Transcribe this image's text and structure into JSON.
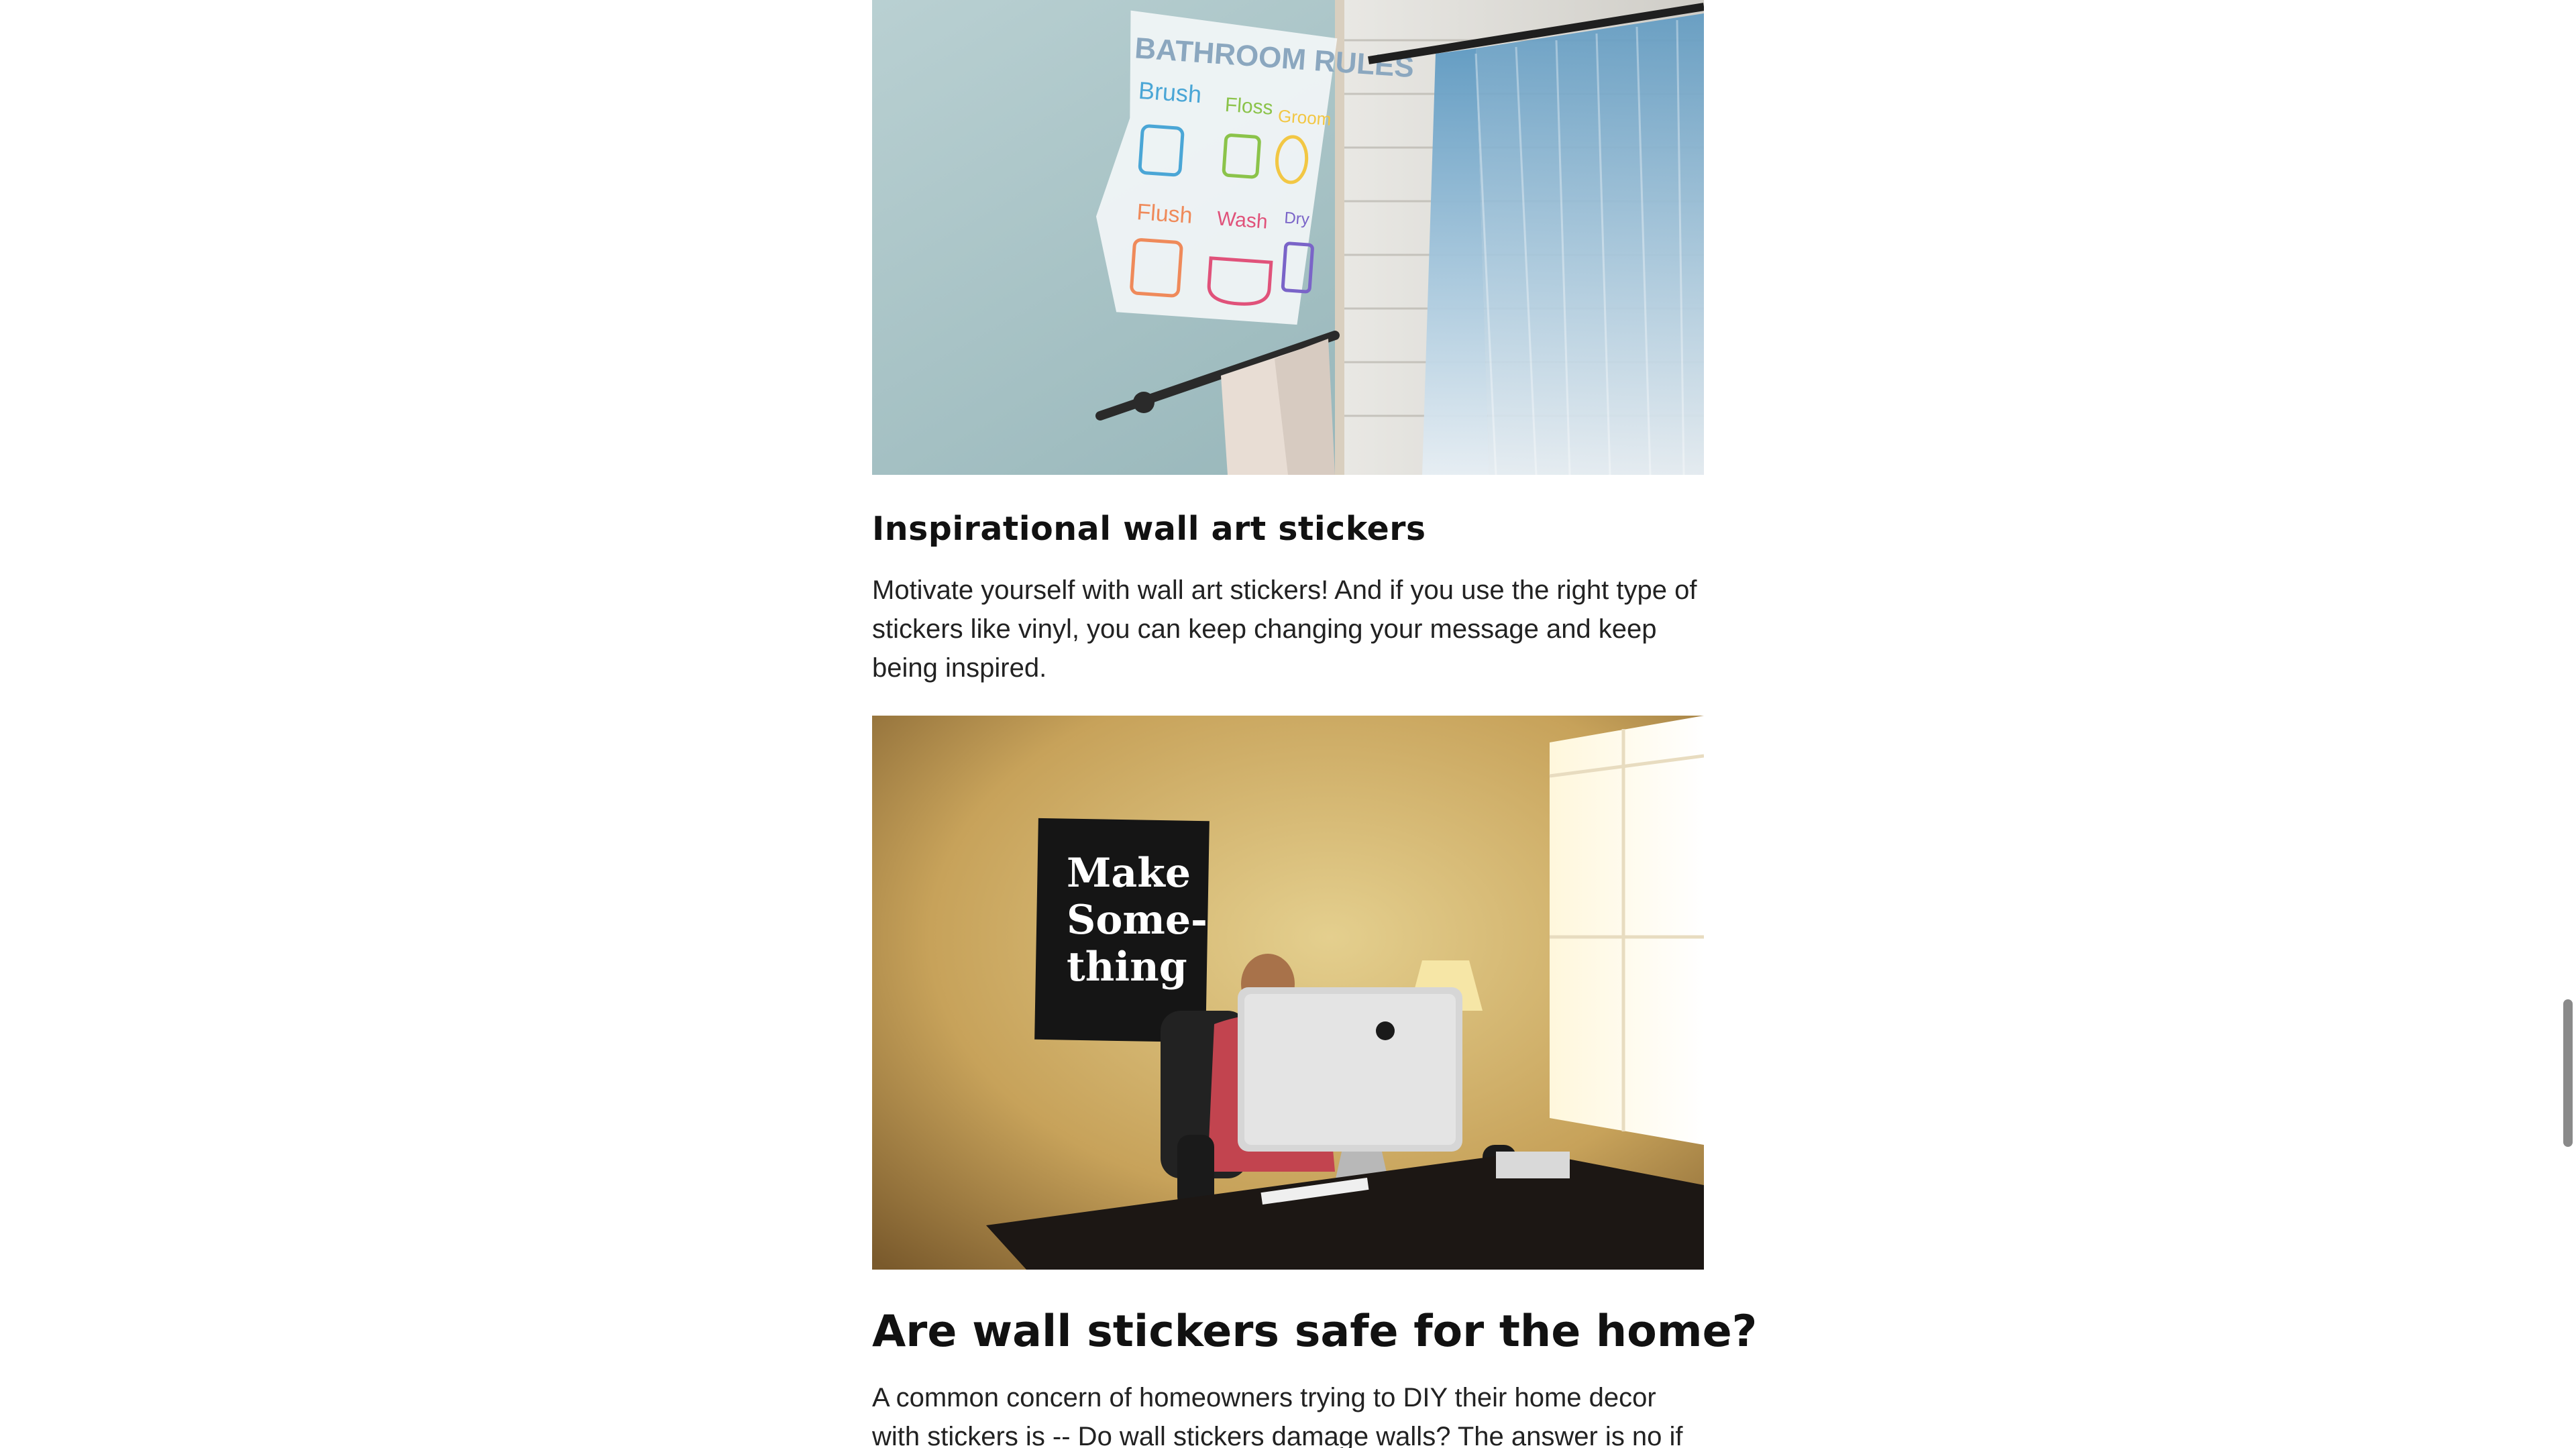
{
  "article": {
    "section_bathroom": {
      "image_alt": "Bathroom rules wall sticker above towel bar next to shower curtain",
      "sign_title": "BATHROOM RULES",
      "sign_items": [
        "Brush",
        "Floss",
        "Groom",
        "Flush",
        "Wash",
        "Dry"
      ]
    },
    "section_inspirational": {
      "heading": "Inspirational wall art stickers",
      "paragraph": "Motivate yourself with wall art stickers! And if you use the right type of stickers like vinyl, you can keep changing your message and keep being inspired."
    },
    "section_office": {
      "poster_lines": [
        "Make",
        "Some-",
        "thing"
      ]
    },
    "section_safety": {
      "heading": "Are wall stickers safe for the home?",
      "paragraph": "A common concern of homeowners trying to DIY their home decor with stickers is -- Do wall stickers damage walls? The answer is no if you use the"
    }
  },
  "colors": {
    "heading": "#111111",
    "body_text": "#222222",
    "bathroom_wall": "#a9c3c6",
    "office_wall": "#c9a45a"
  }
}
